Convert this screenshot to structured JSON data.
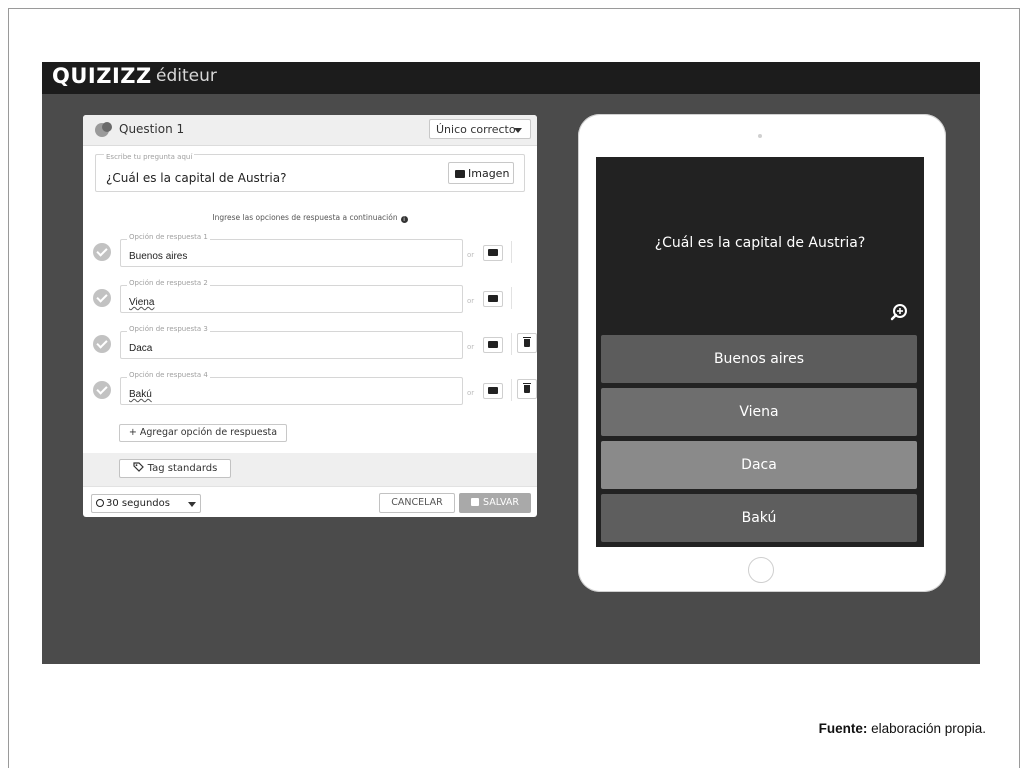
{
  "header": {
    "logo": "QUIZIZZ",
    "subtitle": "éditeur"
  },
  "editor": {
    "title": "Question 1",
    "question_type": "Único correcto",
    "question_label": "Escribe tu pregunta aquí",
    "question_text": "¿Cuál es la capital de Austria?",
    "image_button": "Imagen",
    "hint": "Ingrese las opciones de respuesta a continuación",
    "or_text": "or",
    "options": [
      {
        "label": "Opción de respuesta 1",
        "value": "Buenos aires"
      },
      {
        "label": "Opción de respuesta 2",
        "value": "Viena"
      },
      {
        "label": "Opción de respuesta 3",
        "value": "Daca"
      },
      {
        "label": "Opción de respuesta 4",
        "value": "Bakú"
      }
    ],
    "add_option": "+ Agregar opción de respuesta",
    "tag_standards": "Tag standards",
    "timer": "30 segundos",
    "cancel": "CANCELAR",
    "save": "SALVAR"
  },
  "preview": {
    "question": "¿Cuál es la capital de Austria?",
    "answers": [
      "Buenos aires",
      "Viena",
      "Daca",
      "Bakú"
    ],
    "answer_colors": [
      "#5c5c5c",
      "#6e6e6e",
      "#8a8a8a",
      "#5e5e5e"
    ]
  },
  "caption": {
    "label": "Fuente:",
    "text": " elaboración propia."
  }
}
